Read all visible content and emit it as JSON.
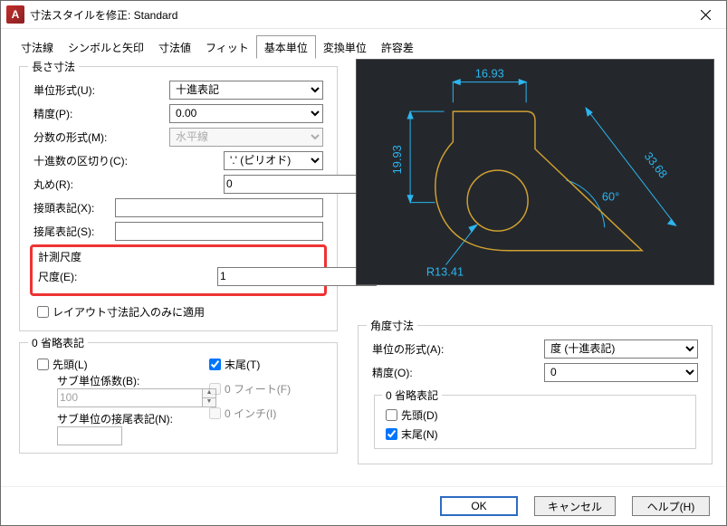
{
  "window": {
    "app_letter": "A",
    "title": "寸法スタイルを修正: Standard"
  },
  "tabs": {
    "items": [
      "寸法線",
      "シンボルと矢印",
      "寸法値",
      "フィット",
      "基本単位",
      "変換単位",
      "許容差"
    ],
    "active_index": 4
  },
  "length_dim": {
    "legend": "長さ寸法",
    "unit_format_label": "単位形式(U):",
    "unit_format_value": "十進表記",
    "precision_label": "精度(P):",
    "precision_value": "0.00",
    "fraction_label": "分数の形式(M):",
    "fraction_value": "水平線",
    "decimal_sep_label": "十進数の区切り(C):",
    "decimal_sep_value": "'.' (ピリオド)",
    "round_label": "丸め(R):",
    "round_value": "0",
    "prefix_label": "接頭表記(X):",
    "prefix_value": "",
    "suffix_label": "接尾表記(S):",
    "suffix_value": ""
  },
  "scale": {
    "legend": "計測尺度",
    "scale_label": "尺度(E):",
    "scale_value": "1",
    "layout_only_label": "レイアウト寸法記入のみに適用"
  },
  "zero_sup": {
    "legend": "0 省略表記",
    "leading_label": "先頭(L)",
    "sub_factor_label": "サブ単位係数(B):",
    "sub_factor_value": "100",
    "sub_suffix_label": "サブ単位の接尾表記(N):",
    "sub_suffix_value": "",
    "trailing_label": "末尾(T)",
    "feet_label": "0 フィート(F)",
    "inch_label": "0 インチ(I)"
  },
  "preview": {
    "dim_top": "16.93",
    "dim_left": "19.93",
    "dim_diag": "33.68",
    "dim_ang": "60°",
    "dim_rad": "R13.41"
  },
  "angle": {
    "legend": "角度寸法",
    "format_label": "単位の形式(A):",
    "format_value": "度 (十進表記)",
    "prec_label": "精度(O):",
    "prec_value": "0",
    "zero_legend": "0 省略表記",
    "lead_label": "先頭(D)",
    "trail_label": "末尾(N)"
  },
  "footer": {
    "ok": "OK",
    "cancel": "キャンセル",
    "help": "ヘルプ(H)"
  }
}
